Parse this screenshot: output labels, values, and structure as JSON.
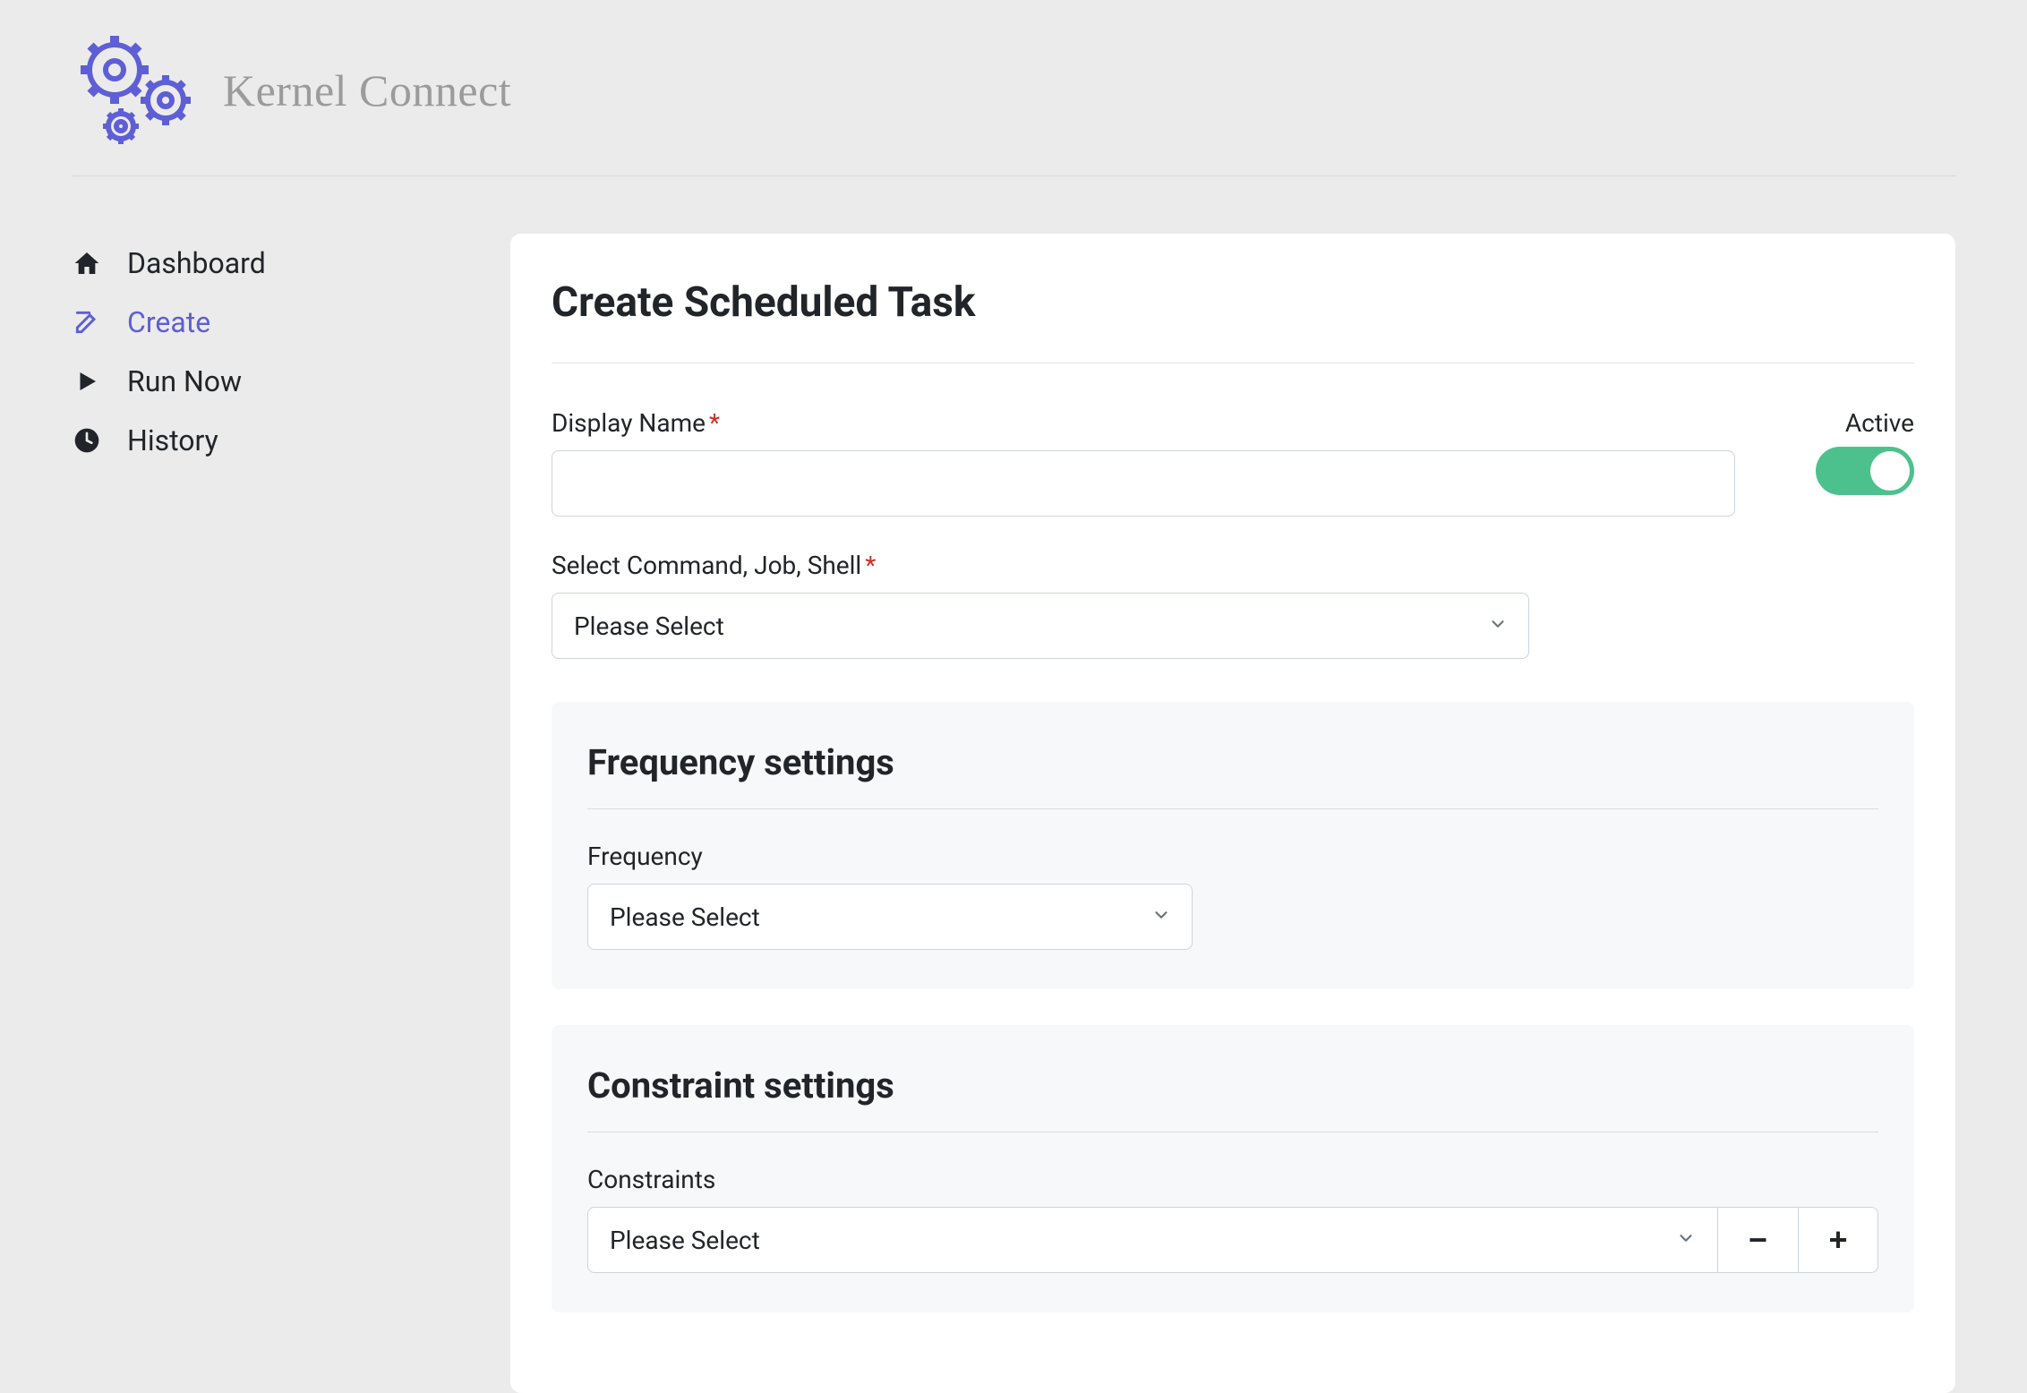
{
  "brand": {
    "name": "Kernel Connect"
  },
  "sidebar": {
    "items": [
      {
        "label": "Dashboard",
        "icon": "home-icon"
      },
      {
        "label": "Create",
        "icon": "edit-icon"
      },
      {
        "label": "Run Now",
        "icon": "play-icon"
      },
      {
        "label": "History",
        "icon": "clock-icon"
      }
    ],
    "active_index": 1
  },
  "main": {
    "title": "Create Scheduled Task",
    "display_name_label": "Display Name",
    "display_name_value": "",
    "active_label": "Active",
    "active_value": true,
    "command_label": "Select Command, Job, Shell",
    "command_value": "Please Select",
    "frequency_section_title": "Frequency settings",
    "frequency_label": "Frequency",
    "frequency_value": "Please Select",
    "constraint_section_title": "Constraint settings",
    "constraints_label": "Constraints",
    "constraints_value": "Please Select",
    "remove_label": "−",
    "add_label": "+"
  },
  "colors": {
    "accent": "#5e5ed6",
    "toggle_on": "#4cc18d",
    "required": "#c9302c"
  }
}
